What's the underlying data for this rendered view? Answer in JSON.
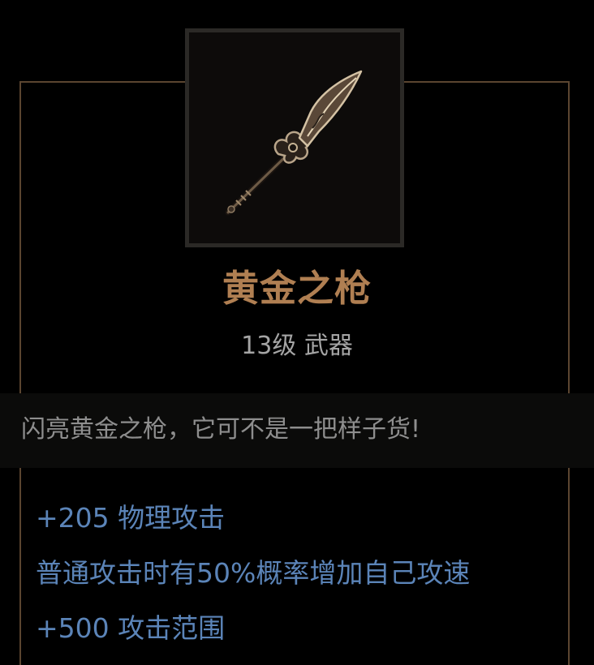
{
  "item": {
    "icon": "golden-spear-icon",
    "name": "黄金之枪",
    "meta": "13级 武器",
    "flavor": "闪亮黄金之枪，它可不是一把样子货!",
    "stats": [
      "+205 物理攻击",
      "普通攻击时有50%概率增加自己攻速",
      "+500 攻击范围"
    ]
  },
  "colors": {
    "name": "#b07f52",
    "meta": "#a5a5a5",
    "flavor": "#8e8e8e",
    "stat": "#5b84b8",
    "frame": "#5b4530"
  }
}
